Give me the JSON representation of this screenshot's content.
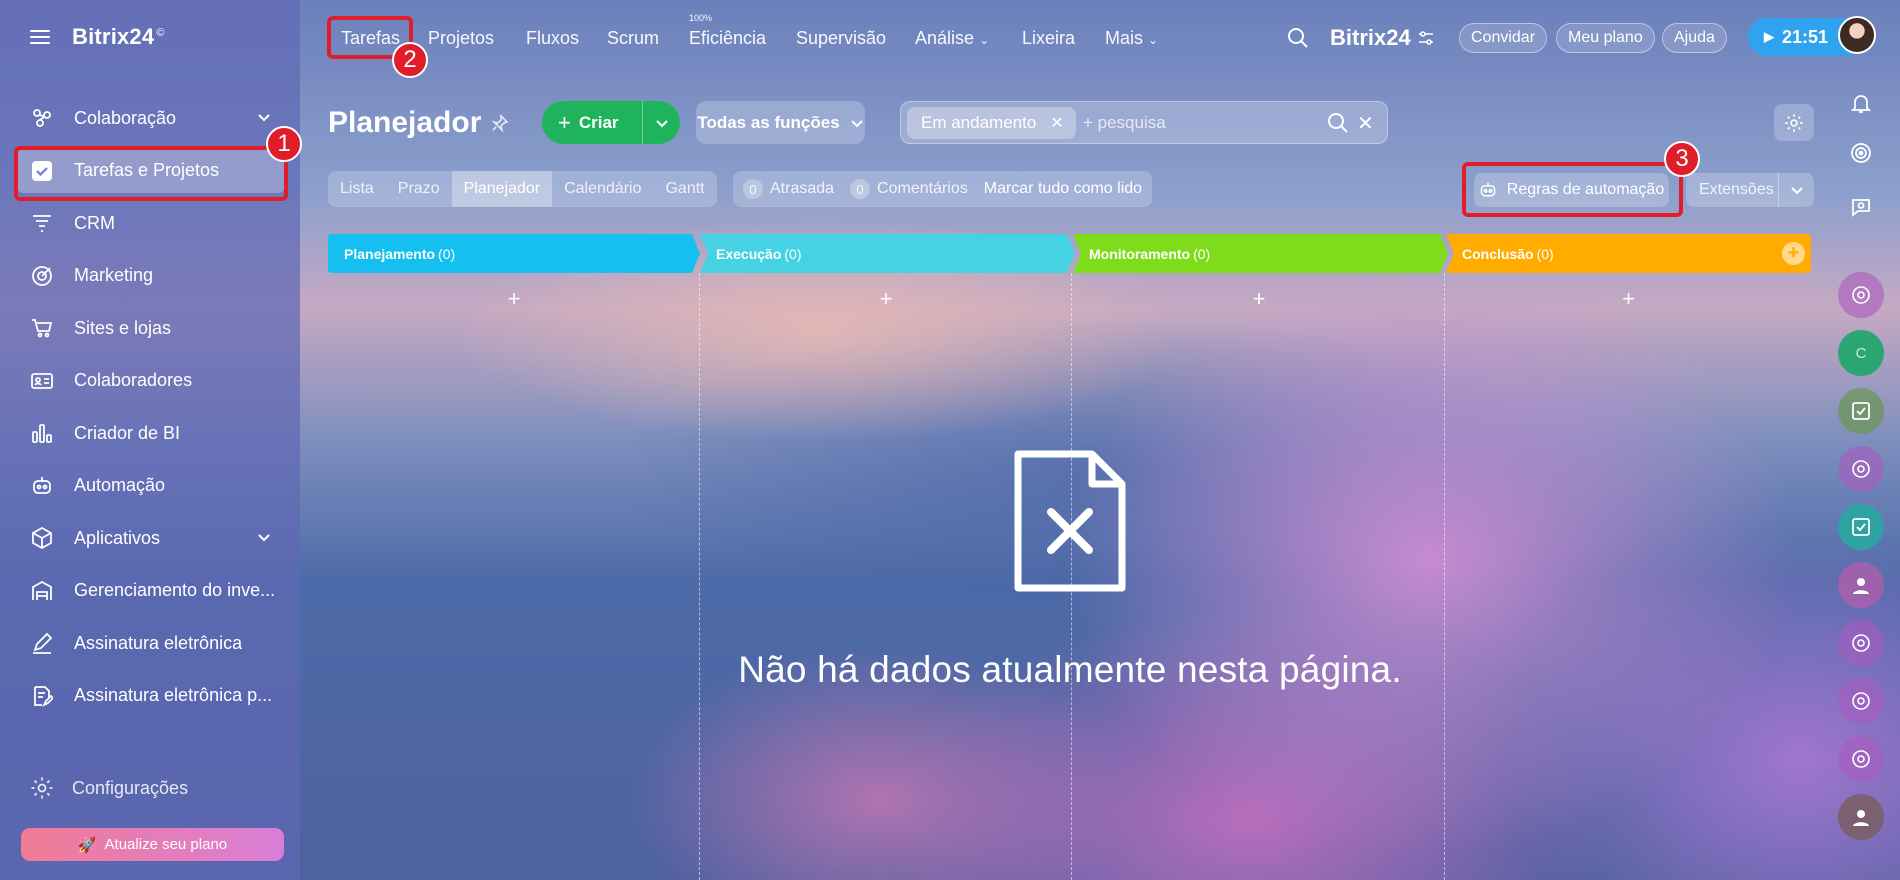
{
  "app": {
    "brand": "Bitrix24",
    "brand_mark": "©",
    "workspace": "Bitrix24"
  },
  "colors": {
    "accent_green": "#1fb45b",
    "timer_blue": "#2fa3f0",
    "highlight_red": "#e01e2a",
    "stage_planning": "#15c0f0",
    "stage_execution": "#45d2e2",
    "stage_monitoring": "#7fdc1a",
    "stage_conclusion": "#ffab00"
  },
  "sidebar": {
    "items": [
      {
        "label": "Colaboração",
        "icon": "collaboration-icon",
        "has_submenu": true
      },
      {
        "label": "Tarefas e Projetos",
        "icon": "checkbox-icon",
        "active": true
      },
      {
        "label": "CRM",
        "icon": "crm-icon"
      },
      {
        "label": "Marketing",
        "icon": "marketing-icon"
      },
      {
        "label": "Sites e lojas",
        "icon": "cart-icon"
      },
      {
        "label": "Colaboradores",
        "icon": "id-card-icon"
      },
      {
        "label": "Criador de BI",
        "icon": "bar-chart-icon"
      },
      {
        "label": "Automação",
        "icon": "robot-icon"
      },
      {
        "label": "Aplicativos",
        "icon": "cube-icon",
        "has_submenu": true
      },
      {
        "label": "Gerenciamento do inve...",
        "icon": "warehouse-icon"
      },
      {
        "label": "Assinatura eletrônica",
        "icon": "pen-icon"
      },
      {
        "label": "Assinatura eletrônica p...",
        "icon": "document-sign-icon"
      }
    ],
    "settings_label": "Configurações",
    "upgrade_label": "Atualize seu plano"
  },
  "topnav": {
    "tabs": [
      "Tarefas",
      "Projetos",
      "Fluxos",
      "Scrum",
      "Eficiência",
      "Supervisão",
      "Análise",
      "Lixeira",
      "Mais"
    ],
    "efficiency_badge": "100%",
    "invite_label": "Convidar",
    "plan_label": "Meu plano",
    "help_label": "Ajuda",
    "timer": "21:51"
  },
  "toolbar": {
    "page_title": "Planejador",
    "create_label": "Criar",
    "roles_label": "Todas as funções",
    "filter_chip": "Em andamento",
    "search_placeholder": "+ pesquisa"
  },
  "views": {
    "tabs": [
      "Lista",
      "Prazo",
      "Planejador",
      "Calendário",
      "Gantt"
    ],
    "selected": "Planejador",
    "overdue_count": "0",
    "overdue_label": "Atrasada",
    "comments_count": "0",
    "comments_label": "Comentários",
    "mark_read_label": "Marcar tudo como lido",
    "automation_label": "Regras de automação",
    "extensions_label": "Extensões"
  },
  "board": {
    "stages": [
      {
        "name": "Planejamento",
        "count": "(0)"
      },
      {
        "name": "Execução",
        "count": "(0)"
      },
      {
        "name": "Monitoramento",
        "count": "(0)"
      },
      {
        "name": "Conclusão",
        "count": "(0)"
      }
    ],
    "add_symbol": "+",
    "empty_message": "Não há dados atualmente nesta página."
  },
  "annotations": {
    "step1": "1",
    "step2": "2",
    "step3": "3"
  }
}
